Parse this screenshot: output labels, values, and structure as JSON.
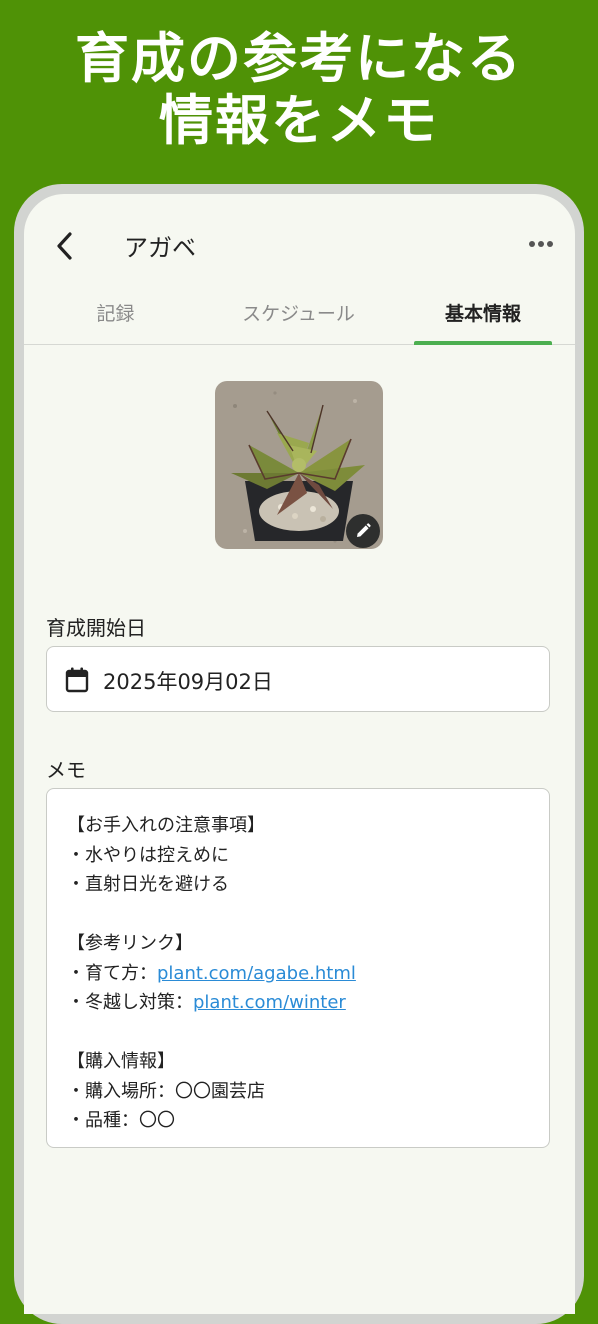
{
  "promo": {
    "line1": "育成の参考になる",
    "line2": "情報をメモ"
  },
  "appbar": {
    "title": "アガベ",
    "back_icon": "chevron-left-icon",
    "more_icon": "more-horizontal-icon"
  },
  "tabs": [
    {
      "label": "記録",
      "active": false
    },
    {
      "label": "スケジュール",
      "active": false
    },
    {
      "label": "基本情報",
      "active": true
    }
  ],
  "photo": {
    "subject": "agave plant in pot",
    "edit_icon": "pencil-icon"
  },
  "start_date": {
    "label": "育成開始日",
    "value": "2025年09月02日",
    "icon": "calendar-icon"
  },
  "memo": {
    "label": "メモ",
    "lines": [
      {
        "text": "【お手入れの注意事項】"
      },
      {
        "text": "・水やりは控えめに"
      },
      {
        "text": "・直射日光を避ける"
      },
      {
        "text": ""
      },
      {
        "text": "【参考リンク】"
      },
      {
        "text": "・育て方：",
        "link": "plant.com/agabe.html"
      },
      {
        "text": "・冬越し対策：",
        "link": "plant.com/winter"
      },
      {
        "text": ""
      },
      {
        "text": "【購入情報】"
      },
      {
        "text": "・購入場所：〇〇園芸店"
      },
      {
        "text": "・品種：〇〇"
      }
    ]
  },
  "colors": {
    "brand_green": "#4f9206",
    "tab_indicator": "#4caf50",
    "link": "#2a8bd6",
    "background": "#f6f8f1"
  }
}
